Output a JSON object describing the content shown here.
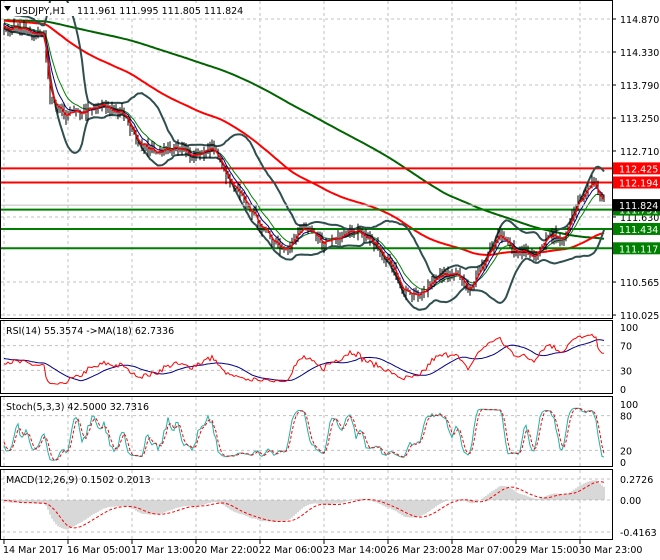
{
  "main": {
    "symbol_label": "USDJPY,H1",
    "ohlc_label": "111.961 111.995 111.805 111.824",
    "price_ticks": [
      "114.870",
      "114.330",
      "113.790",
      "113.250",
      "112.710",
      "111.630",
      "110.565",
      "110.025"
    ],
    "levels": [
      {
        "value": 112.425,
        "label": "112.425",
        "color": "#ff0000"
      },
      {
        "value": 112.194,
        "label": "112.194",
        "color": "#ff0000"
      },
      {
        "value": 111.751,
        "label": "111.751",
        "color": "#008000"
      },
      {
        "value": 111.434,
        "label": "111.434",
        "color": "#008000"
      },
      {
        "value": 111.117,
        "label": "111.117",
        "color": "#008000"
      }
    ],
    "current_price": {
      "value": 111.824,
      "label": "111.824"
    }
  },
  "rsi": {
    "label": "RSI(14) 55.3574  ->MA(18) 62.7336",
    "ticks": [
      "100",
      "70",
      "30",
      "0"
    ]
  },
  "stoch": {
    "label": "Stoch(5,3,3) 42.5000 32.7316",
    "ticks": [
      "100",
      "80",
      "20",
      "0"
    ]
  },
  "macd": {
    "label": "MACD(12,26,9) 0.1502 0.2013",
    "ticks": [
      "0.2726",
      "0.00",
      "-0.4163"
    ]
  },
  "time_axis": [
    "14 Mar 2017",
    "16 Mar 05:00",
    "17 Mar 13:00",
    "20 Mar 22:00",
    "22 Mar 06:00",
    "23 Mar 14:00",
    "26 Mar 23:00",
    "28 Mar 07:00",
    "29 Mar 15:00",
    "30 Mar 23:00"
  ],
  "chart_data": {
    "type": "candlestick",
    "title": "USDJPY,H1",
    "ylim": [
      110.025,
      114.87
    ],
    "close_path_keypoints": [
      [
        0,
        114.75
      ],
      [
        40,
        114.6
      ],
      [
        46,
        113.5
      ],
      [
        60,
        113.3
      ],
      [
        80,
        113.35
      ],
      [
        100,
        113.45
      ],
      [
        120,
        113.3
      ],
      [
        135,
        112.85
      ],
      [
        150,
        112.7
      ],
      [
        170,
        112.75
      ],
      [
        190,
        112.65
      ],
      [
        210,
        112.75
      ],
      [
        225,
        112.2
      ],
      [
        240,
        111.9
      ],
      [
        260,
        111.4
      ],
      [
        280,
        111.1
      ],
      [
        300,
        111.45
      ],
      [
        320,
        111.2
      ],
      [
        350,
        111.45
      ],
      [
        370,
        111.2
      ],
      [
        385,
        110.9
      ],
      [
        400,
        110.4
      ],
      [
        415,
        110.3
      ],
      [
        430,
        110.6
      ],
      [
        450,
        110.75
      ],
      [
        465,
        110.4
      ],
      [
        480,
        110.9
      ],
      [
        495,
        111.35
      ],
      [
        510,
        111.1
      ],
      [
        530,
        111.0
      ],
      [
        545,
        111.35
      ],
      [
        560,
        111.3
      ],
      [
        575,
        111.9
      ],
      [
        590,
        112.2
      ],
      [
        600,
        111.85
      ]
    ],
    "overlays": [
      "Bollinger Bands",
      "MA fast (red)",
      "MA (blue)",
      "MA (green)",
      "MA 100 (red)",
      "MA 200 (green)"
    ],
    "indicators": [
      "RSI(14)",
      "Stoch(5,3,3)",
      "MACD(12,26,9)"
    ]
  }
}
